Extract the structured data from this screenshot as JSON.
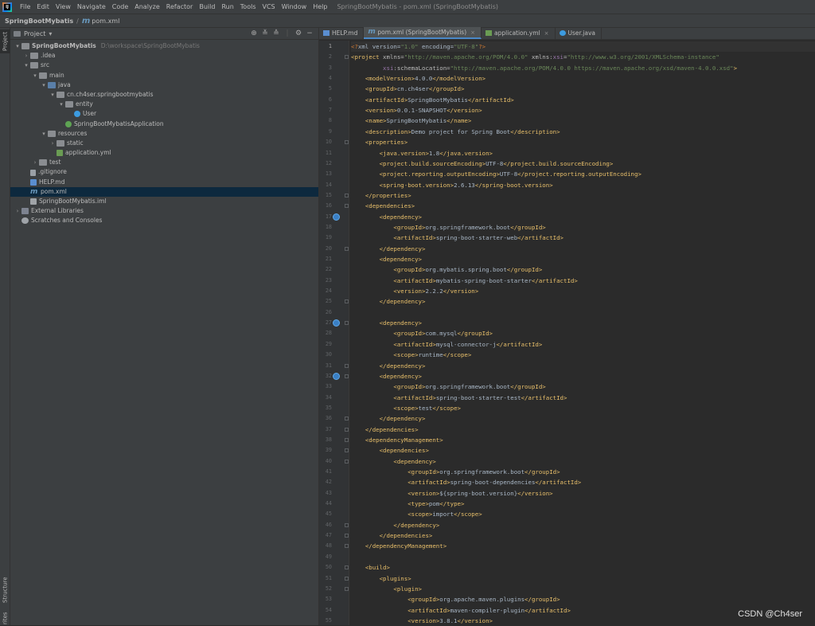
{
  "menu": {
    "items": [
      "File",
      "Edit",
      "View",
      "Navigate",
      "Code",
      "Analyze",
      "Refactor",
      "Build",
      "Run",
      "Tools",
      "VCS",
      "Window",
      "Help"
    ],
    "window_title": "SpringBootMybatis - pom.xml (SpringBootMybatis)"
  },
  "breadcrumb": {
    "project": "SpringBootMybatis",
    "file": "pom.xml"
  },
  "side_tabs": {
    "project": "Project",
    "structure": "Structure",
    "favorites": "rites"
  },
  "project_panel": {
    "title": "Project",
    "dropdown": "▾"
  },
  "tree": [
    {
      "label": "SpringBootMybatis",
      "extra": "D:\\workspace\\SpringBootMybatis",
      "arrow": "▾",
      "icon": "folder",
      "indent": 0,
      "bold": true
    },
    {
      "label": ".idea",
      "arrow": "›",
      "icon": "folder",
      "indent": 1
    },
    {
      "label": "src",
      "arrow": "▾",
      "icon": "folder",
      "indent": 1
    },
    {
      "label": "main",
      "arrow": "▾",
      "icon": "folder",
      "indent": 2
    },
    {
      "label": "java",
      "arrow": "▾",
      "icon": "src",
      "indent": 3
    },
    {
      "label": "cn.ch4ser.springbootmybatis",
      "arrow": "▾",
      "icon": "pkg",
      "indent": 4
    },
    {
      "label": "entity",
      "arrow": "▾",
      "icon": "pkg",
      "indent": 5
    },
    {
      "label": "User",
      "arrow": "",
      "icon": "cls",
      "indent": 6
    },
    {
      "label": "SpringBootMybatisApplication",
      "arrow": "",
      "icon": "spring",
      "indent": 5
    },
    {
      "label": "resources",
      "arrow": "▾",
      "icon": "folder",
      "indent": 3
    },
    {
      "label": "static",
      "arrow": "›",
      "icon": "folder",
      "indent": 4
    },
    {
      "label": "application.yml",
      "arrow": "",
      "icon": "yml",
      "indent": 4
    },
    {
      "label": "test",
      "arrow": "›",
      "icon": "folder",
      "indent": 2
    },
    {
      "label": ".gitignore",
      "arrow": "",
      "icon": "file",
      "indent": 1
    },
    {
      "label": "HELP.md",
      "arrow": "",
      "icon": "md",
      "indent": 1
    },
    {
      "label": "pom.xml",
      "arrow": "",
      "icon": "pom",
      "indent": 1,
      "selected": true
    },
    {
      "label": "SpringBootMybatis.iml",
      "arrow": "",
      "icon": "iml",
      "indent": 1
    },
    {
      "label": "External Libraries",
      "arrow": "›",
      "icon": "lib",
      "indent": 0
    },
    {
      "label": "Scratches and Consoles",
      "arrow": "",
      "icon": "scr",
      "indent": 0
    }
  ],
  "tabs": [
    {
      "label": "HELP.md",
      "icon": "md",
      "active": false,
      "close": ""
    },
    {
      "label": "pom.xml (SpringBootMybatis)",
      "icon": "pom",
      "active": true,
      "close": "×"
    },
    {
      "label": "application.yml",
      "icon": "yml",
      "active": false,
      "close": "×"
    },
    {
      "label": "User.java",
      "icon": "cls",
      "active": false,
      "close": ""
    }
  ],
  "code_lines": [
    [
      [
        "pi",
        "<?"
      ],
      [
        "txt",
        "xml version="
      ],
      [
        "str",
        "\"1.0\""
      ],
      [
        "txt",
        " encoding="
      ],
      [
        "str",
        "\"UTF-8\""
      ],
      [
        "pi",
        "?>"
      ]
    ],
    [
      [
        "tag",
        "<project "
      ],
      [
        "attr",
        "xmlns="
      ],
      [
        "str",
        "\"http://maven.apache.org/POM/4.0.0\""
      ],
      [
        "attr",
        " xmlns:"
      ],
      [
        "ns",
        "xsi"
      ],
      [
        "attr",
        "="
      ],
      [
        "str",
        "\"http://www.w3.org/2001/XMLSchema-instance\""
      ]
    ],
    [
      [
        "txt",
        "         "
      ],
      [
        "ns",
        "xsi"
      ],
      [
        "attr",
        ":schemaLocation="
      ],
      [
        "str",
        "\"http://maven.apache.org/POM/4.0.0 https://maven.apache.org/xsd/maven-4.0.0.xsd\""
      ],
      [
        "tag",
        ">"
      ]
    ],
    [
      [
        "txt",
        "    "
      ],
      [
        "tag",
        "<modelVersion>"
      ],
      [
        "txt",
        "4.0.0"
      ],
      [
        "tag",
        "</modelVersion>"
      ]
    ],
    [
      [
        "txt",
        "    "
      ],
      [
        "tag",
        "<groupId>"
      ],
      [
        "txt",
        "cn.ch4ser"
      ],
      [
        "tag",
        "</groupId>"
      ]
    ],
    [
      [
        "txt",
        "    "
      ],
      [
        "tag",
        "<artifactId>"
      ],
      [
        "txt",
        "SpringBootMybatis"
      ],
      [
        "tag",
        "</artifactId>"
      ]
    ],
    [
      [
        "txt",
        "    "
      ],
      [
        "tag",
        "<version>"
      ],
      [
        "txt",
        "0.0.1-SNAPSHOT"
      ],
      [
        "tag",
        "</version>"
      ]
    ],
    [
      [
        "txt",
        "    "
      ],
      [
        "tag",
        "<name>"
      ],
      [
        "txt",
        "SpringBootMybatis"
      ],
      [
        "tag",
        "</name>"
      ]
    ],
    [
      [
        "txt",
        "    "
      ],
      [
        "tag",
        "<description>"
      ],
      [
        "txt",
        "Demo project for Spring Boot"
      ],
      [
        "tag",
        "</description>"
      ]
    ],
    [
      [
        "txt",
        "    "
      ],
      [
        "tag",
        "<properties>"
      ]
    ],
    [
      [
        "txt",
        "        "
      ],
      [
        "tag",
        "<java.version>"
      ],
      [
        "txt",
        "1.8"
      ],
      [
        "tag",
        "</java.version>"
      ]
    ],
    [
      [
        "txt",
        "        "
      ],
      [
        "tag",
        "<project.build.sourceEncoding>"
      ],
      [
        "txt",
        "UTF-8"
      ],
      [
        "tag",
        "</project.build.sourceEncoding>"
      ]
    ],
    [
      [
        "txt",
        "        "
      ],
      [
        "tag",
        "<project.reporting.outputEncoding>"
      ],
      [
        "txt",
        "UTF-8"
      ],
      [
        "tag",
        "</project.reporting.outputEncoding>"
      ]
    ],
    [
      [
        "txt",
        "        "
      ],
      [
        "tag",
        "<spring-boot.version>"
      ],
      [
        "txt",
        "2.6.13"
      ],
      [
        "tag",
        "</spring-boot.version>"
      ]
    ],
    [
      [
        "txt",
        "    "
      ],
      [
        "tag",
        "</properties>"
      ]
    ],
    [
      [
        "txt",
        "    "
      ],
      [
        "tag",
        "<dependencies>"
      ]
    ],
    [
      [
        "txt",
        "        "
      ],
      [
        "tag",
        "<dependency>"
      ]
    ],
    [
      [
        "txt",
        "            "
      ],
      [
        "tag",
        "<groupId>"
      ],
      [
        "txt",
        "org.springframework.boot"
      ],
      [
        "tag",
        "</groupId>"
      ]
    ],
    [
      [
        "txt",
        "            "
      ],
      [
        "tag",
        "<artifactId>"
      ],
      [
        "txt",
        "spring-boot-starter-web"
      ],
      [
        "tag",
        "</artifactId>"
      ]
    ],
    [
      [
        "txt",
        "        "
      ],
      [
        "tag",
        "</dependency>"
      ]
    ],
    [
      [
        "txt",
        "        "
      ],
      [
        "tag",
        "<dependency>"
      ]
    ],
    [
      [
        "txt",
        "            "
      ],
      [
        "tag",
        "<groupId>"
      ],
      [
        "txt",
        "org.mybatis.spring.boot"
      ],
      [
        "tag",
        "</groupId>"
      ]
    ],
    [
      [
        "txt",
        "            "
      ],
      [
        "tag",
        "<artifactId>"
      ],
      [
        "txt",
        "mybatis-spring-boot-starter"
      ],
      [
        "tag",
        "</artifactId>"
      ]
    ],
    [
      [
        "txt",
        "            "
      ],
      [
        "tag",
        "<version>"
      ],
      [
        "txt",
        "2.2.2"
      ],
      [
        "tag",
        "</version>"
      ]
    ],
    [
      [
        "txt",
        "        "
      ],
      [
        "tag",
        "</dependency>"
      ]
    ],
    [],
    [
      [
        "txt",
        "        "
      ],
      [
        "tag",
        "<dependency>"
      ]
    ],
    [
      [
        "txt",
        "            "
      ],
      [
        "tag",
        "<groupId>"
      ],
      [
        "txt",
        "com.mysql"
      ],
      [
        "tag",
        "</groupId>"
      ]
    ],
    [
      [
        "txt",
        "            "
      ],
      [
        "tag",
        "<artifactId>"
      ],
      [
        "txt",
        "mysql-connector-j"
      ],
      [
        "tag",
        "</artifactId>"
      ]
    ],
    [
      [
        "txt",
        "            "
      ],
      [
        "tag",
        "<scope>"
      ],
      [
        "txt",
        "runtime"
      ],
      [
        "tag",
        "</scope>"
      ]
    ],
    [
      [
        "txt",
        "        "
      ],
      [
        "tag",
        "</dependency>"
      ]
    ],
    [
      [
        "txt",
        "        "
      ],
      [
        "tag",
        "<dependency>"
      ]
    ],
    [
      [
        "txt",
        "            "
      ],
      [
        "tag",
        "<groupId>"
      ],
      [
        "txt",
        "org.springframework.boot"
      ],
      [
        "tag",
        "</groupId>"
      ]
    ],
    [
      [
        "txt",
        "            "
      ],
      [
        "tag",
        "<artifactId>"
      ],
      [
        "txt",
        "spring-boot-starter-test"
      ],
      [
        "tag",
        "</artifactId>"
      ]
    ],
    [
      [
        "txt",
        "            "
      ],
      [
        "tag",
        "<scope>"
      ],
      [
        "txt",
        "test"
      ],
      [
        "tag",
        "</scope>"
      ]
    ],
    [
      [
        "txt",
        "        "
      ],
      [
        "tag",
        "</dependency>"
      ]
    ],
    [
      [
        "txt",
        "    "
      ],
      [
        "tag",
        "</dependencies>"
      ]
    ],
    [
      [
        "txt",
        "    "
      ],
      [
        "tag",
        "<dependencyManagement>"
      ]
    ],
    [
      [
        "txt",
        "        "
      ],
      [
        "tag",
        "<dependencies>"
      ]
    ],
    [
      [
        "txt",
        "            "
      ],
      [
        "tag",
        "<dependency>"
      ]
    ],
    [
      [
        "txt",
        "                "
      ],
      [
        "tag",
        "<groupId>"
      ],
      [
        "txt",
        "org.springframework.boot"
      ],
      [
        "tag",
        "</groupId>"
      ]
    ],
    [
      [
        "txt",
        "                "
      ],
      [
        "tag",
        "<artifactId>"
      ],
      [
        "txt",
        "spring-boot-dependencies"
      ],
      [
        "tag",
        "</artifactId>"
      ]
    ],
    [
      [
        "txt",
        "                "
      ],
      [
        "tag",
        "<version>"
      ],
      [
        "txt",
        "${spring-boot.version}"
      ],
      [
        "tag",
        "</version>"
      ]
    ],
    [
      [
        "txt",
        "                "
      ],
      [
        "tag",
        "<type>"
      ],
      [
        "txt",
        "pom"
      ],
      [
        "tag",
        "</type>"
      ]
    ],
    [
      [
        "txt",
        "                "
      ],
      [
        "tag",
        "<scope>"
      ],
      [
        "txt",
        "import"
      ],
      [
        "tag",
        "</scope>"
      ]
    ],
    [
      [
        "txt",
        "            "
      ],
      [
        "tag",
        "</dependency>"
      ]
    ],
    [
      [
        "txt",
        "        "
      ],
      [
        "tag",
        "</dependencies>"
      ]
    ],
    [
      [
        "txt",
        "    "
      ],
      [
        "tag",
        "</dependencyManagement>"
      ]
    ],
    [],
    [
      [
        "txt",
        "    "
      ],
      [
        "tag",
        "<build>"
      ]
    ],
    [
      [
        "txt",
        "        "
      ],
      [
        "tag",
        "<plugins>"
      ]
    ],
    [
      [
        "txt",
        "            "
      ],
      [
        "tag",
        "<plugin>"
      ]
    ],
    [
      [
        "txt",
        "                "
      ],
      [
        "tag",
        "<groupId>"
      ],
      [
        "txt",
        "org.apache.maven.plugins"
      ],
      [
        "tag",
        "</groupId>"
      ]
    ],
    [
      [
        "txt",
        "                "
      ],
      [
        "tag",
        "<artifactId>"
      ],
      [
        "txt",
        "maven-compiler-plugin"
      ],
      [
        "tag",
        "</artifactId>"
      ]
    ],
    [
      [
        "txt",
        "                "
      ],
      [
        "tag",
        "<version>"
      ],
      [
        "txt",
        "3.8.1"
      ],
      [
        "tag",
        "</version>"
      ]
    ]
  ],
  "gutter_icons_lines": [
    17,
    27,
    32
  ],
  "fold_lines": [
    2,
    10,
    15,
    16,
    20,
    25,
    27,
    31,
    32,
    36,
    37,
    38,
    39,
    40,
    46,
    47,
    48,
    50,
    51,
    52
  ],
  "watermark": "CSDN @Ch4ser"
}
